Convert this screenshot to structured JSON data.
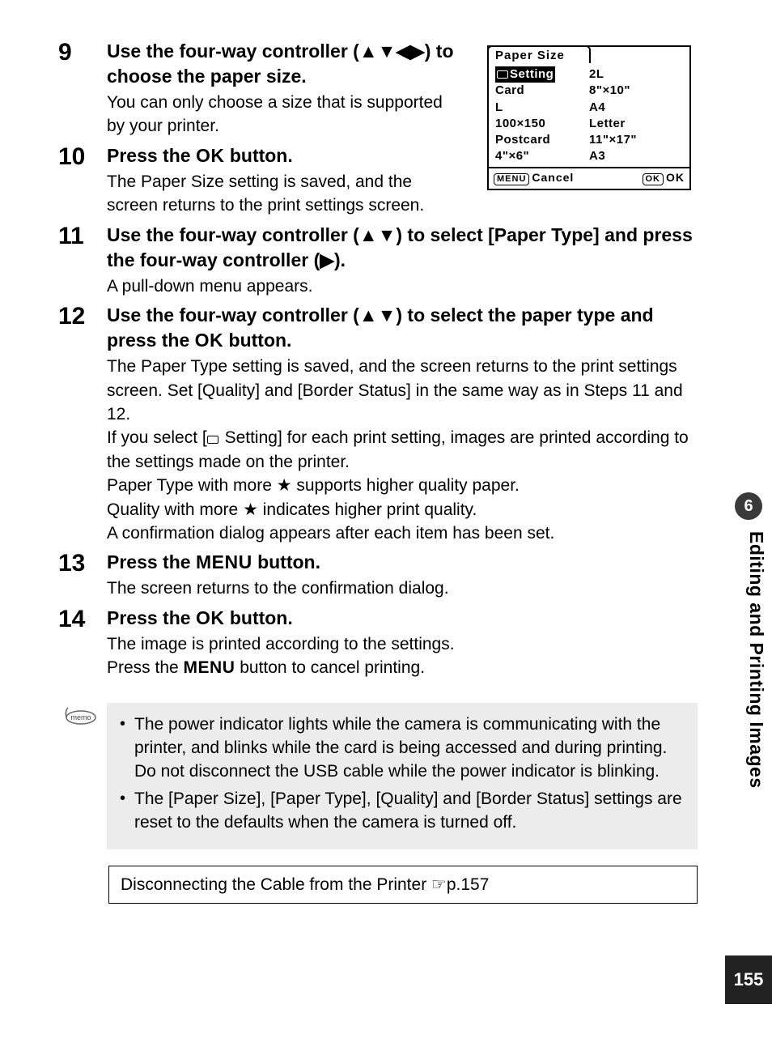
{
  "steps": {
    "s9": {
      "num": "9",
      "title_pre": "Use the four-way controller (",
      "arrows": "▲▼◀▶",
      "title_post": ") to choose the paper size.",
      "desc": "You can only choose a size that is supported by your printer."
    },
    "s10": {
      "num": "10",
      "title_pre": "Press the ",
      "ok": "OK",
      "title_post": " button.",
      "desc": "The Paper Size setting is saved, and the screen returns to the print settings screen."
    },
    "s11": {
      "num": "11",
      "title_pre": "Use the four-way controller (",
      "arrows1": "▲▼",
      "title_mid": ") to select [Paper Type] and press the four-way controller (",
      "arrows2": "▶",
      "title_post": ").",
      "desc": "A pull-down menu appears."
    },
    "s12": {
      "num": "12",
      "title_pre": "Use the four-way controller (",
      "arrows": "▲▼",
      "title_mid": ") to select the paper type and press the ",
      "ok": "OK",
      "title_post": " button.",
      "desc1": "The Paper Type setting is saved, and the screen returns to the print settings screen. Set [Quality] and [Border Status] in the same way as in Steps 11 and 12.",
      "desc2_pre": "If you select [",
      "desc2_post": " Setting] for each print setting, images are printed according to the settings made on the printer.",
      "desc3_pre": "Paper Type with more ",
      "star": "★",
      "desc3_post": " supports higher quality paper.",
      "desc4_pre": "Quality with more ",
      "desc4_post": " indicates higher print quality.",
      "desc5": "A confirmation dialog appears after each item has been set."
    },
    "s13": {
      "num": "13",
      "title_pre": "Press the ",
      "menu": "MENU",
      "title_post": " button.",
      "desc": "The screen returns to the confirmation dialog."
    },
    "s14": {
      "num": "14",
      "title_pre": "Press the ",
      "ok": "OK",
      "title_post": " button.",
      "desc1": "The image is printed according to the settings.",
      "desc2_pre": "Press the ",
      "menu": "MENU",
      "desc2_post": " button to cancel printing."
    }
  },
  "lcd": {
    "title": "Paper Size",
    "col1": [
      "Setting",
      "Card",
      "L",
      "100×150",
      "Postcard",
      "4\"×6\""
    ],
    "col2": [
      "2L",
      "8\"×10\"",
      "A4",
      "Letter",
      "11\"×17\"",
      "A3"
    ],
    "footer_left_btn": "MENU",
    "footer_left": "Cancel",
    "footer_right_btn": "OK",
    "footer_right": "OK"
  },
  "memo": {
    "label": "memo",
    "items": [
      "The power indicator lights while the camera is communicating with the printer, and blinks while the card is being accessed and during printing. Do not disconnect the USB cable while the power indicator is blinking.",
      "The [Paper Size], [Paper Type], [Quality] and [Border Status] settings are reset to the defaults when the camera is turned off."
    ]
  },
  "ref": {
    "text": "Disconnecting the Cable from the Printer ☞p.157"
  },
  "side": {
    "chapter_num": "6",
    "chapter_title": "Editing and Printing Images",
    "page_num": "155"
  }
}
